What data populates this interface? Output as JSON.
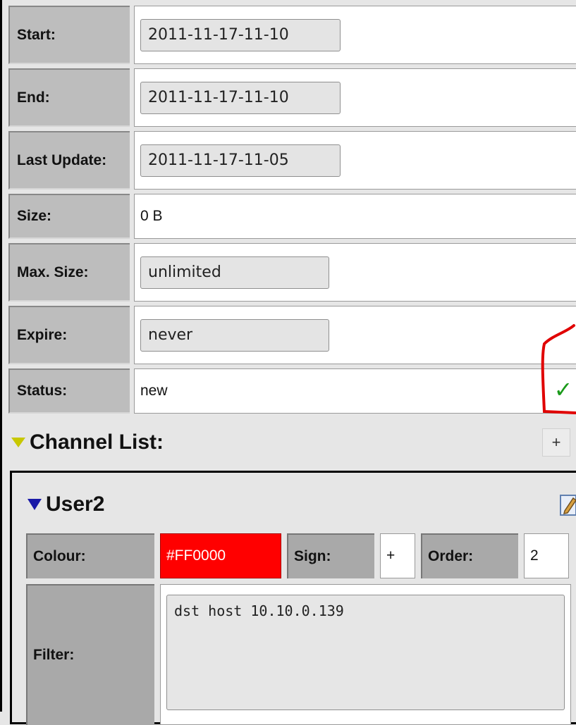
{
  "properties": [
    {
      "label": "Start:",
      "value": "2011-11-17-11-10"
    },
    {
      "label": "End:",
      "value": "2011-11-17-11-10"
    },
    {
      "label": "Last Update:",
      "value": "2011-11-17-11-05"
    },
    {
      "label": "Size:",
      "value": "0 B"
    },
    {
      "label": "Max. Size:",
      "value": "unlimited"
    },
    {
      "label": "Expire:",
      "value": "never"
    },
    {
      "label": "Status:",
      "value": "new"
    }
  ],
  "status_icon": {
    "glyph": "✓",
    "name": "checkmark-icon",
    "color": "#1a9a1a"
  },
  "channel_list": {
    "title": "Channel List:",
    "add_label": "+"
  },
  "channel": {
    "name": "User2",
    "colour_label": "Colour:",
    "colour_value": "#FF0000",
    "colour_swatch": "#FF0000",
    "sign_label": "Sign:",
    "sign_value": "+",
    "order_label": "Order:",
    "order_value": "2",
    "filter_label": "Filter:",
    "filter_value": "dst host 10.10.0.139"
  },
  "colors": {
    "highlight_annotation": "#e00000"
  }
}
